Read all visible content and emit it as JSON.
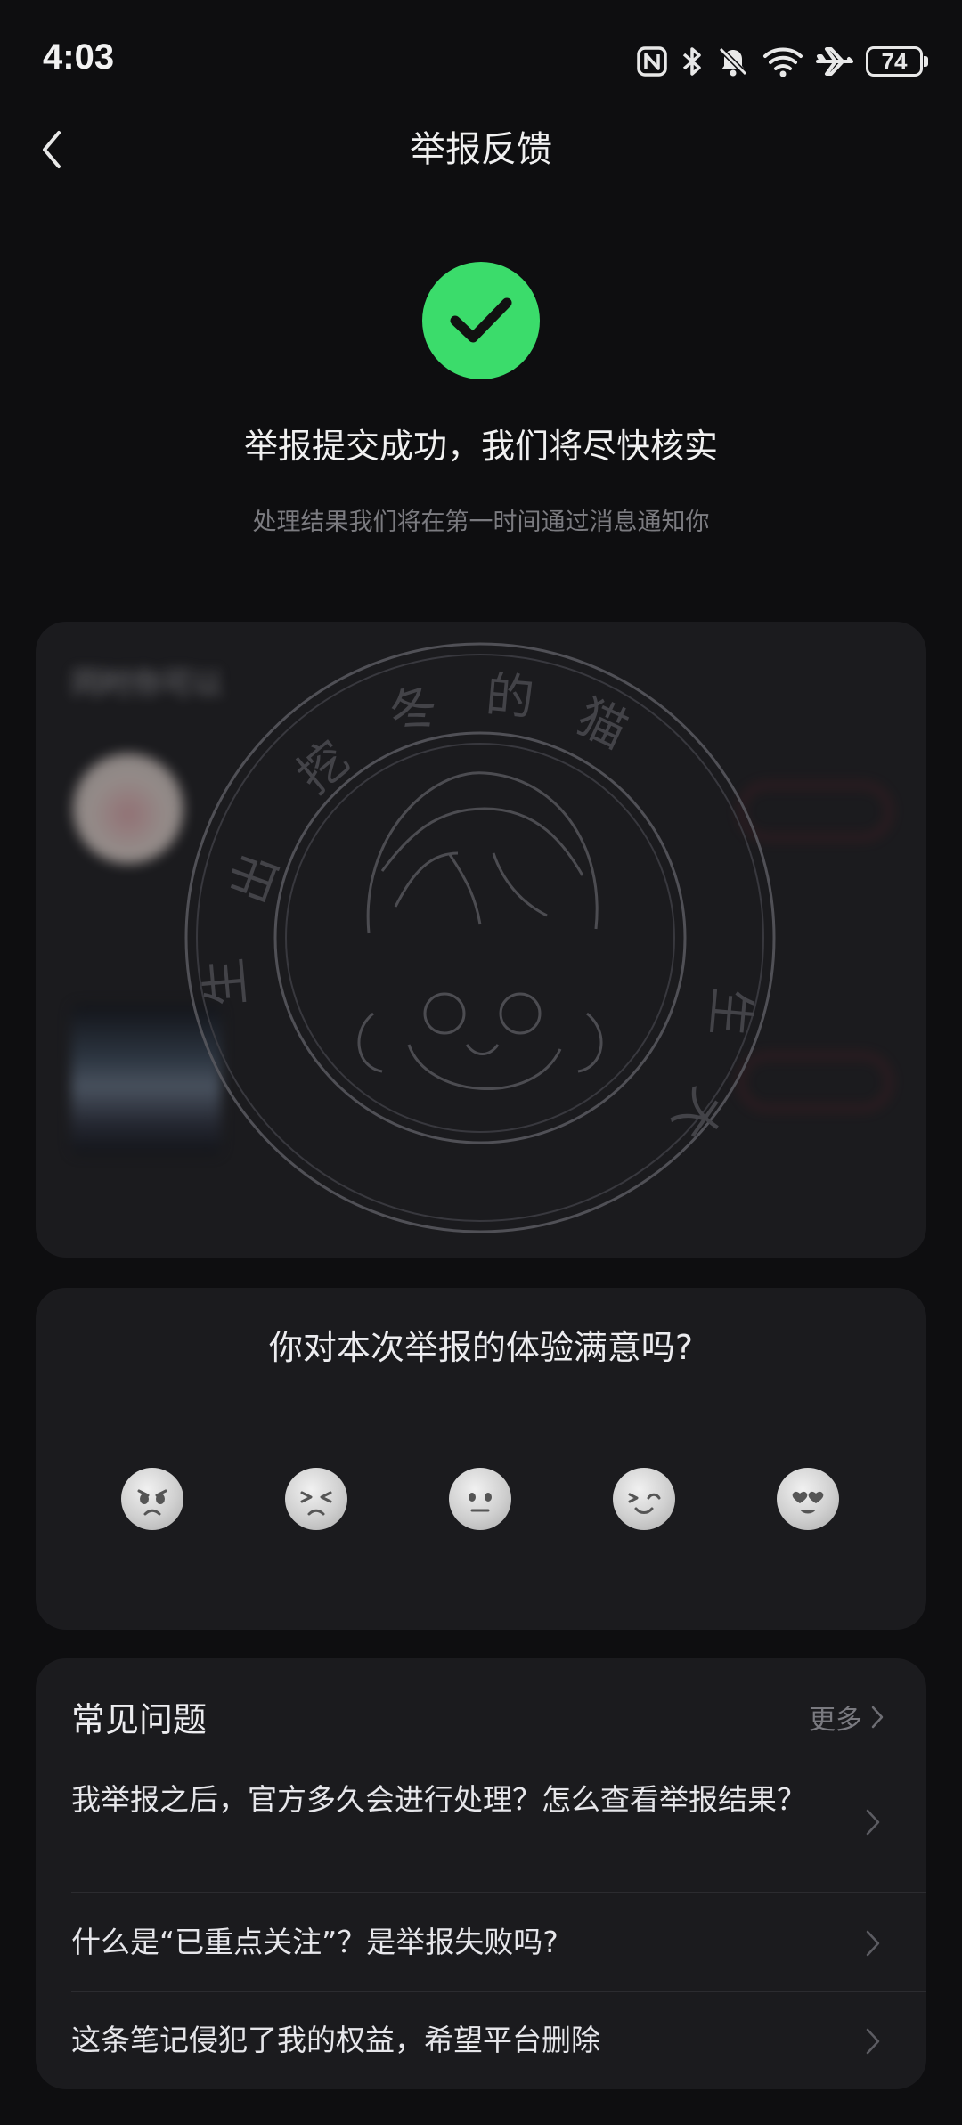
{
  "status_bar": {
    "time": "4:03",
    "battery": "74",
    "icons": [
      "nfc-icon",
      "bluetooth-icon",
      "bell-muted-icon",
      "wifi-icon",
      "airplane-icon",
      "battery-icon"
    ]
  },
  "nav": {
    "title": "举报反馈",
    "back_icon": "chevron-left-icon"
  },
  "success": {
    "title": "举报提交成功，我们将尽快核实",
    "subtitle": "处理结果我们将在第一时间通过消息通知你",
    "icon": "check-circle-icon",
    "accent": "#3bdc6b"
  },
  "recommend": {
    "heading": "同时你可以",
    "items": [
      {
        "title": "",
        "button": "",
        "desc": ""
      },
      {
        "title": "",
        "button": "",
        "desc": ""
      }
    ],
    "blurred": true,
    "watermark": "挖出地冬的猫"
  },
  "rating": {
    "question": "你对本次举报的体验满意吗?",
    "options": [
      "angry-face-icon",
      "sad-face-icon",
      "neutral-face-icon",
      "smile-face-icon",
      "heart-eyes-face-icon"
    ]
  },
  "faq": {
    "title": "常见问题",
    "more": "更多",
    "items": [
      "我举报之后，官方多久会进行处理？怎么查看举报结果？",
      "什么是“已重点关注”？是举报失败吗?",
      "这条笔记侵犯了我的权益，希望平台删除"
    ]
  },
  "colors": {
    "background": "#0e0e10",
    "card": "#1b1b1e",
    "accent_red": "#e0324b"
  }
}
